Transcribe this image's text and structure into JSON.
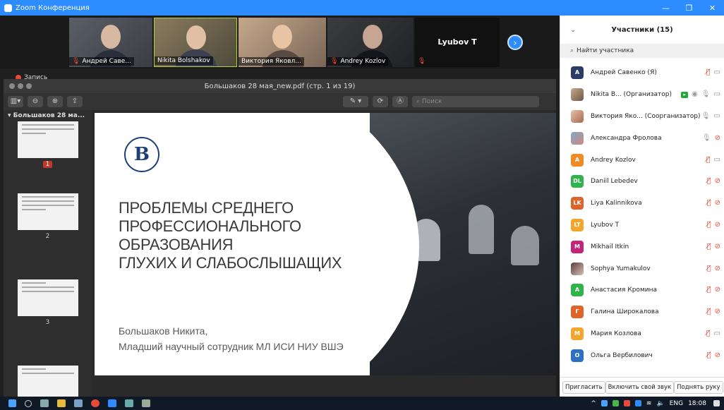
{
  "window": {
    "title": "Zoom Конференция"
  },
  "window_controls": {
    "minimize": "—",
    "maximize": "❐",
    "close": "✕"
  },
  "videos": [
    {
      "name": "Андрей Саве..."
    },
    {
      "name": "Nikita Bolshakov"
    },
    {
      "name": "Виктория Яковл..."
    },
    {
      "name": "Andrey Kozlov"
    },
    {
      "name": "Lyubov T"
    }
  ],
  "video_next": "›",
  "recording": {
    "label": "Запись"
  },
  "pdf": {
    "title": "Большаков 28 мая_new.pdf (стр. 1 из 19)",
    "search_placeholder": "Поиск",
    "sidebar_title": "Большаков 28 ма...",
    "page_numbers": [
      "1",
      "2",
      "3"
    ]
  },
  "slide": {
    "logo_letter": "В",
    "title_lines": [
      "ПРОБЛЕМЫ СРЕДНЕГО",
      "ПРОФЕССИОНАЛЬНОГО",
      "ОБРАЗОВАНИЯ",
      "ГЛУХИХ И СЛАБОСЛЫШАЩИХ"
    ],
    "author_lines": [
      "Большаков Никита,",
      "Младший научный сотрудник МЛ ИСИ НИУ ВШЭ"
    ]
  },
  "participants_panel": {
    "title": "Участники (15)",
    "search_placeholder": "Найти участника",
    "participants": [
      {
        "initials": "А",
        "name": "Андрей Савенко (Я)",
        "color": "#2b3b66",
        "mic": "muted",
        "cam": "on"
      },
      {
        "initials": "",
        "name": "Nikita B... (Организатор)",
        "color": "",
        "mic": "on",
        "cam": "on",
        "share": true,
        "photo": "photo1"
      },
      {
        "initials": "",
        "name": "Виктория Яко... (Соорганизатор)",
        "color": "",
        "mic": "on",
        "cam": "on",
        "photo": "photo2"
      },
      {
        "initials": "",
        "name": "Александра Фролова",
        "color": "",
        "mic": "on",
        "cam": "off",
        "photo": "photo3"
      },
      {
        "initials": "A",
        "name": "Andrey Kozlov",
        "color": "#f08a24",
        "mic": "muted",
        "cam": "on"
      },
      {
        "initials": "DL",
        "name": "Daniil Lebedev",
        "color": "#2fb34a",
        "mic": "muted",
        "cam": "off"
      },
      {
        "initials": "LK",
        "name": "Liya Kalinnikova",
        "color": "#e0632a",
        "mic": "muted",
        "cam": "off"
      },
      {
        "initials": "LT",
        "name": "Lyubov T",
        "color": "#f3a62b",
        "mic": "muted",
        "cam": "off"
      },
      {
        "initials": "M",
        "name": "Mikhail Itkin",
        "color": "#c4237a",
        "mic": "muted",
        "cam": "off"
      },
      {
        "initials": "",
        "name": "Sophya Yumakulov",
        "color": "",
        "mic": "muted",
        "cam": "off",
        "photo": "photo4"
      },
      {
        "initials": "А",
        "name": "Анастасия Кромина",
        "color": "#2fb34a",
        "mic": "muted",
        "cam": "off"
      },
      {
        "initials": "Г",
        "name": "Галина Широкалова",
        "color": "#e0632a",
        "mic": "muted",
        "cam": "off"
      },
      {
        "initials": "М",
        "name": "Мария Козлова",
        "color": "#f3a62b",
        "mic": "muted",
        "cam": "on"
      },
      {
        "initials": "О",
        "name": "Ольга Вербилович",
        "color": "#2d6fc4",
        "mic": "muted",
        "cam": "off"
      }
    ],
    "buttons": {
      "invite": "Пригласить",
      "unmute": "Включить свой звук",
      "raise_hand": "Поднять руку"
    }
  },
  "taskbar": {
    "language": "ENG",
    "time": "18:08"
  },
  "colors": {
    "zoom_blue": "#2d8cff",
    "muted_red": "#e84a3a"
  }
}
